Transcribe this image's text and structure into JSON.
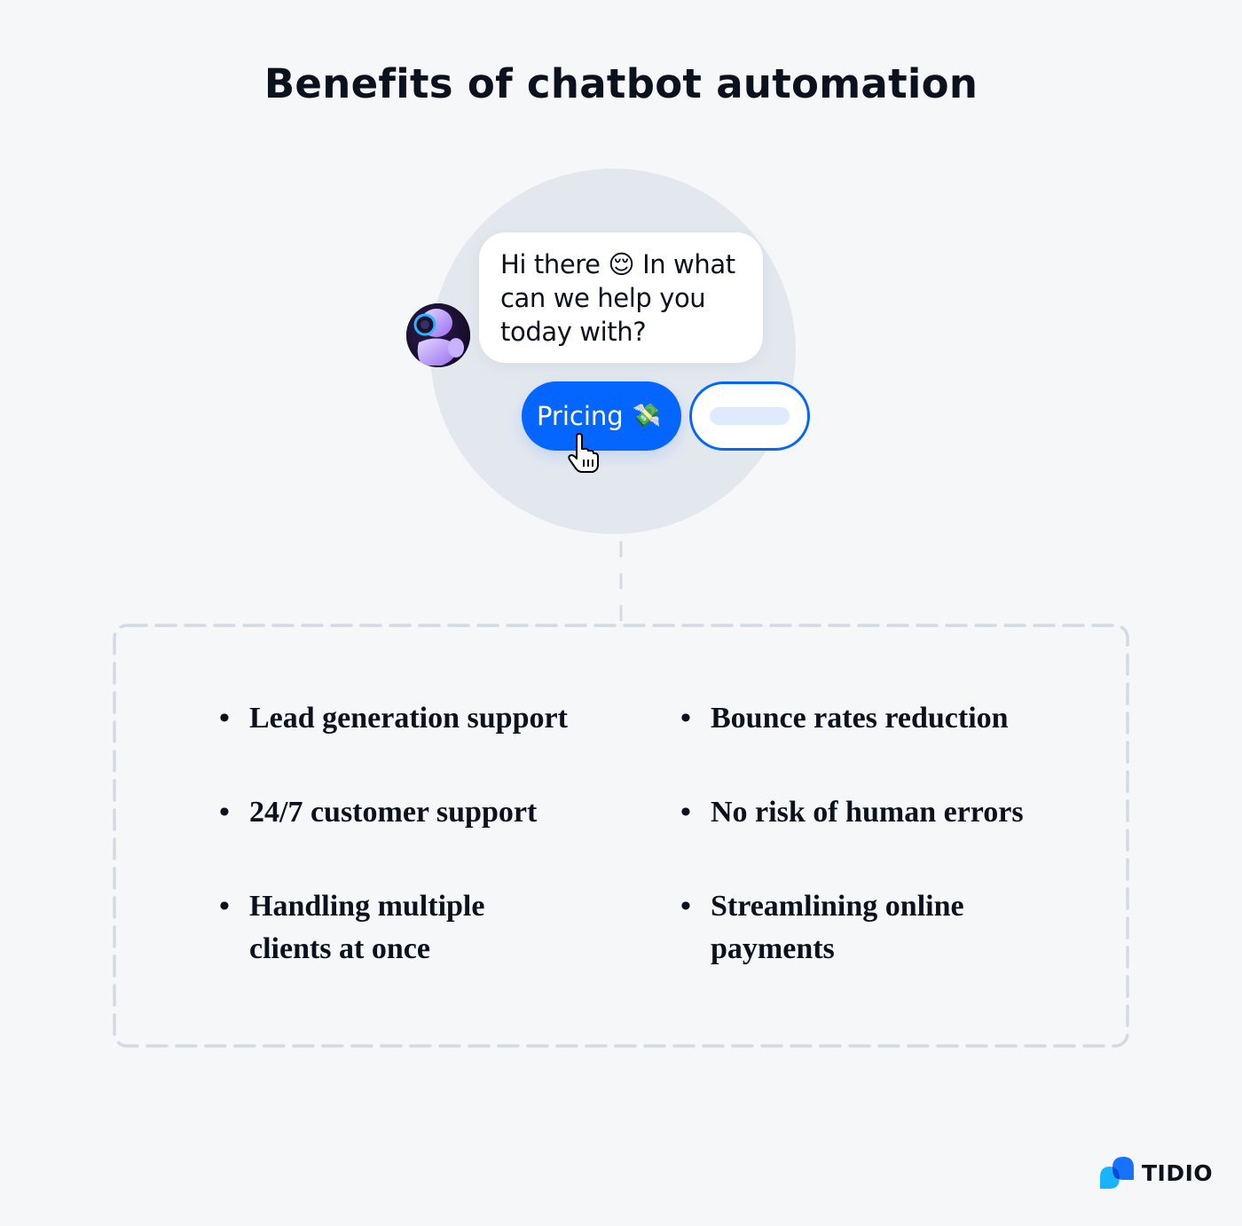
{
  "title": "Benefits of chatbot automation",
  "chat": {
    "message_lines": [
      "Hi there 😌 In what",
      "can we help you",
      "today with?"
    ],
    "avatar_icon": "robot-avatar",
    "quick_replies": [
      {
        "label": "Pricing",
        "emoji": "💸",
        "selected": true
      },
      {
        "label": "",
        "placeholder": true,
        "selected": false
      }
    ],
    "cursor_icon": "hand-pointer-icon"
  },
  "benefits": {
    "left": [
      {
        "lines": [
          "Lead generation support"
        ]
      },
      {
        "lines": [
          "24/7 customer support"
        ]
      },
      {
        "lines": [
          "Handling multiple",
          "clients at once"
        ]
      }
    ],
    "right": [
      {
        "lines": [
          "Bounce rates reduction"
        ]
      },
      {
        "lines": [
          "No risk of human errors"
        ]
      },
      {
        "lines": [
          "Streamlining online",
          "payments"
        ]
      }
    ],
    "bullet": "•"
  },
  "brand": {
    "name": "TIDIO",
    "color_primary": "#0566ff",
    "color_secondary": "#19b4ff"
  },
  "colors": {
    "background": "#f5f7f9",
    "circle": "#e3e8ef",
    "dash": "#d3dae2",
    "text": "#0b111d"
  }
}
